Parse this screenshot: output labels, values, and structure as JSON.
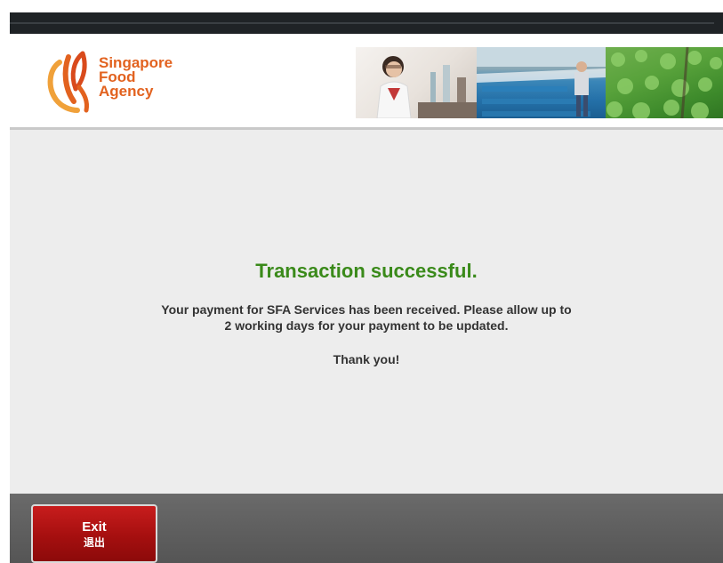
{
  "header": {
    "logo": {
      "line1": "Singapore",
      "line2": "Food",
      "line3": "Agency"
    },
    "banner_images": [
      "lab-scientist",
      "fish-farm",
      "vegetable-farm"
    ]
  },
  "main": {
    "title": "Transaction successful.",
    "message_line1": "Your payment for SFA Services has been received. Please allow up to",
    "message_line2": "2 working days for your payment to be updated.",
    "thanks": "Thank you!"
  },
  "footer": {
    "exit_label": "Exit",
    "exit_sublabel": "退出"
  },
  "colors": {
    "brand_orange": "#e2621f",
    "success_green": "#3a8a1a",
    "exit_red": "#a50f0f",
    "content_bg": "#ededed",
    "footer_bg": "#5f5f5f"
  }
}
